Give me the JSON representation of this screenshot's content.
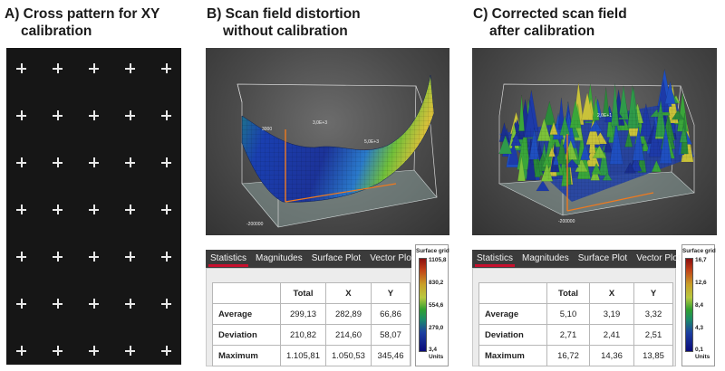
{
  "headings": {
    "a": {
      "line1": "A) Cross pattern for XY",
      "line2": "calibration"
    },
    "b": {
      "line1": "B) Scan field distortion",
      "line2": "without calibration"
    },
    "c": {
      "line1": "C) Corrected scan field",
      "line2": "after calibration"
    }
  },
  "tabs": [
    "Statistics",
    "Magnitudes",
    "Surface Plot",
    "Vector Plot"
  ],
  "active_tab": "Statistics",
  "panel_b": {
    "plot_labels": {
      "z_top": "3000",
      "mid": "3,0E+3",
      "right": "5,0E+3",
      "bottom": "-200000"
    },
    "stats": {
      "columns": [
        "",
        "Total",
        "X",
        "Y"
      ],
      "rows": [
        {
          "label": "Average",
          "total": "299,13",
          "x": "282,89",
          "y": "66,86"
        },
        {
          "label": "Deviation",
          "total": "210,82",
          "x": "214,60",
          "y": "58,07"
        },
        {
          "label": "Maximum",
          "total": "1.105,81",
          "x": "1.050,53",
          "y": "345,46"
        }
      ]
    },
    "legend": {
      "title": "Surface grid",
      "ticks": [
        "1105,8",
        "830,2",
        "554,6",
        "279,0",
        "3,4"
      ],
      "unit": "Units"
    }
  },
  "panel_c": {
    "plot_labels": {
      "z_top": "",
      "mid": "2,0E+1",
      "right": "",
      "bottom": "-200000"
    },
    "stats": {
      "columns": [
        "",
        "Total",
        "X",
        "Y"
      ],
      "rows": [
        {
          "label": "Average",
          "total": "5,10",
          "x": "3,19",
          "y": "3,32"
        },
        {
          "label": "Deviation",
          "total": "2,71",
          "x": "2,41",
          "y": "2,51"
        },
        {
          "label": "Maximum",
          "total": "16,72",
          "x": "14,36",
          "y": "13,85"
        }
      ]
    },
    "legend": {
      "title": "Surface grid",
      "ticks": [
        "16,7",
        "12,6",
        "8,4",
        "4,3",
        "0,1"
      ],
      "unit": "Units"
    }
  },
  "colors": {
    "accent_red": "#c8102e",
    "tab_bar": "#3b3b3b",
    "cross": "#e8e8e8"
  }
}
